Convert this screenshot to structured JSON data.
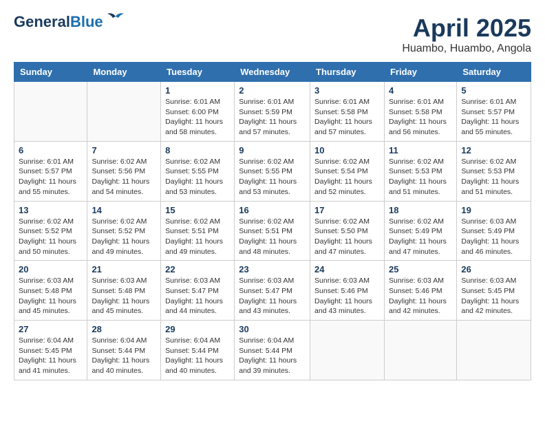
{
  "header": {
    "logo_line1": "General",
    "logo_line2": "Blue",
    "month_year": "April 2025",
    "location": "Huambo, Huambo, Angola"
  },
  "weekdays": [
    "Sunday",
    "Monday",
    "Tuesday",
    "Wednesday",
    "Thursday",
    "Friday",
    "Saturday"
  ],
  "weeks": [
    [
      {
        "day": "",
        "info": ""
      },
      {
        "day": "",
        "info": ""
      },
      {
        "day": "1",
        "info": "Sunrise: 6:01 AM\nSunset: 6:00 PM\nDaylight: 11 hours and 58 minutes."
      },
      {
        "day": "2",
        "info": "Sunrise: 6:01 AM\nSunset: 5:59 PM\nDaylight: 11 hours and 57 minutes."
      },
      {
        "day": "3",
        "info": "Sunrise: 6:01 AM\nSunset: 5:58 PM\nDaylight: 11 hours and 57 minutes."
      },
      {
        "day": "4",
        "info": "Sunrise: 6:01 AM\nSunset: 5:58 PM\nDaylight: 11 hours and 56 minutes."
      },
      {
        "day": "5",
        "info": "Sunrise: 6:01 AM\nSunset: 5:57 PM\nDaylight: 11 hours and 55 minutes."
      }
    ],
    [
      {
        "day": "6",
        "info": "Sunrise: 6:01 AM\nSunset: 5:57 PM\nDaylight: 11 hours and 55 minutes."
      },
      {
        "day": "7",
        "info": "Sunrise: 6:02 AM\nSunset: 5:56 PM\nDaylight: 11 hours and 54 minutes."
      },
      {
        "day": "8",
        "info": "Sunrise: 6:02 AM\nSunset: 5:55 PM\nDaylight: 11 hours and 53 minutes."
      },
      {
        "day": "9",
        "info": "Sunrise: 6:02 AM\nSunset: 5:55 PM\nDaylight: 11 hours and 53 minutes."
      },
      {
        "day": "10",
        "info": "Sunrise: 6:02 AM\nSunset: 5:54 PM\nDaylight: 11 hours and 52 minutes."
      },
      {
        "day": "11",
        "info": "Sunrise: 6:02 AM\nSunset: 5:53 PM\nDaylight: 11 hours and 51 minutes."
      },
      {
        "day": "12",
        "info": "Sunrise: 6:02 AM\nSunset: 5:53 PM\nDaylight: 11 hours and 51 minutes."
      }
    ],
    [
      {
        "day": "13",
        "info": "Sunrise: 6:02 AM\nSunset: 5:52 PM\nDaylight: 11 hours and 50 minutes."
      },
      {
        "day": "14",
        "info": "Sunrise: 6:02 AM\nSunset: 5:52 PM\nDaylight: 11 hours and 49 minutes."
      },
      {
        "day": "15",
        "info": "Sunrise: 6:02 AM\nSunset: 5:51 PM\nDaylight: 11 hours and 49 minutes."
      },
      {
        "day": "16",
        "info": "Sunrise: 6:02 AM\nSunset: 5:51 PM\nDaylight: 11 hours and 48 minutes."
      },
      {
        "day": "17",
        "info": "Sunrise: 6:02 AM\nSunset: 5:50 PM\nDaylight: 11 hours and 47 minutes."
      },
      {
        "day": "18",
        "info": "Sunrise: 6:02 AM\nSunset: 5:49 PM\nDaylight: 11 hours and 47 minutes."
      },
      {
        "day": "19",
        "info": "Sunrise: 6:03 AM\nSunset: 5:49 PM\nDaylight: 11 hours and 46 minutes."
      }
    ],
    [
      {
        "day": "20",
        "info": "Sunrise: 6:03 AM\nSunset: 5:48 PM\nDaylight: 11 hours and 45 minutes."
      },
      {
        "day": "21",
        "info": "Sunrise: 6:03 AM\nSunset: 5:48 PM\nDaylight: 11 hours and 45 minutes."
      },
      {
        "day": "22",
        "info": "Sunrise: 6:03 AM\nSunset: 5:47 PM\nDaylight: 11 hours and 44 minutes."
      },
      {
        "day": "23",
        "info": "Sunrise: 6:03 AM\nSunset: 5:47 PM\nDaylight: 11 hours and 43 minutes."
      },
      {
        "day": "24",
        "info": "Sunrise: 6:03 AM\nSunset: 5:46 PM\nDaylight: 11 hours and 43 minutes."
      },
      {
        "day": "25",
        "info": "Sunrise: 6:03 AM\nSunset: 5:46 PM\nDaylight: 11 hours and 42 minutes."
      },
      {
        "day": "26",
        "info": "Sunrise: 6:03 AM\nSunset: 5:45 PM\nDaylight: 11 hours and 42 minutes."
      }
    ],
    [
      {
        "day": "27",
        "info": "Sunrise: 6:04 AM\nSunset: 5:45 PM\nDaylight: 11 hours and 41 minutes."
      },
      {
        "day": "28",
        "info": "Sunrise: 6:04 AM\nSunset: 5:44 PM\nDaylight: 11 hours and 40 minutes."
      },
      {
        "day": "29",
        "info": "Sunrise: 6:04 AM\nSunset: 5:44 PM\nDaylight: 11 hours and 40 minutes."
      },
      {
        "day": "30",
        "info": "Sunrise: 6:04 AM\nSunset: 5:44 PM\nDaylight: 11 hours and 39 minutes."
      },
      {
        "day": "",
        "info": ""
      },
      {
        "day": "",
        "info": ""
      },
      {
        "day": "",
        "info": ""
      }
    ]
  ]
}
